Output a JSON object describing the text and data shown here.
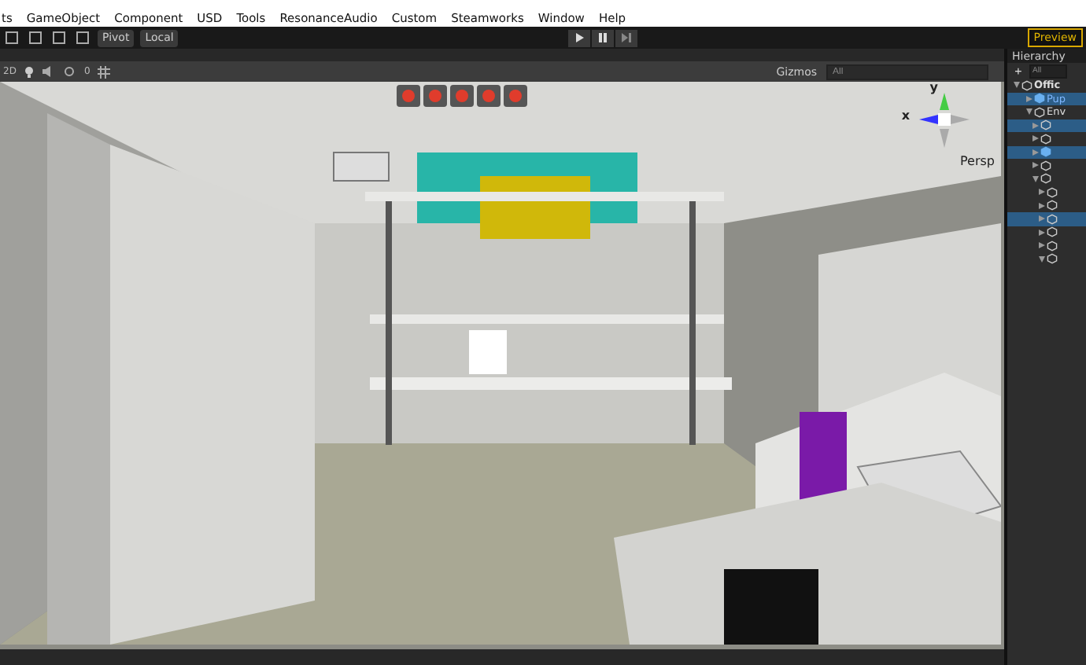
{
  "menu_bar": {
    "items": [
      "ts",
      "GameObject",
      "Component",
      "USD",
      "Tools",
      "ResonanceAudio",
      "Custom",
      "Steamworks",
      "Window",
      "Help"
    ]
  },
  "toolbar": {
    "pivot": "Pivot",
    "local": "Local",
    "play_selected": false,
    "preview": "Preview"
  },
  "scene_toolbar": {
    "mode_2d": "2D",
    "hidden_count": "0",
    "gizmos": "Gizmos",
    "search_placeholder": "All"
  },
  "scene": {
    "projection": "Persp",
    "axis_y": "y",
    "axis_x": "x"
  },
  "hierarchy": {
    "title": "Hierarchy",
    "add": "+",
    "search_placeholder": "All",
    "rows": [
      {
        "label": "Offic",
        "kind": "scene",
        "selected": false,
        "expanded": true
      },
      {
        "label": "Pup",
        "kind": "prefab",
        "selected": true,
        "expanded": false
      },
      {
        "label": "Env",
        "kind": "object",
        "selected": false,
        "expanded": true
      },
      {
        "kind": "object",
        "selected": true,
        "expanded": false
      },
      {
        "kind": "object",
        "selected": false,
        "expanded": false
      },
      {
        "kind": "prefab",
        "selected": true,
        "expanded": false
      },
      {
        "kind": "object",
        "selected": false,
        "expanded": false
      },
      {
        "kind": "object",
        "selected": false,
        "expanded": true
      },
      {
        "kind": "object",
        "selected": false,
        "expanded": false
      },
      {
        "kind": "object",
        "selected": false,
        "expanded": false
      },
      {
        "kind": "object",
        "selected": true,
        "expanded": false
      },
      {
        "kind": "object",
        "selected": false,
        "expanded": false
      },
      {
        "kind": "object",
        "selected": false,
        "expanded": false
      },
      {
        "kind": "object",
        "selected": false,
        "expanded": true
      }
    ]
  }
}
